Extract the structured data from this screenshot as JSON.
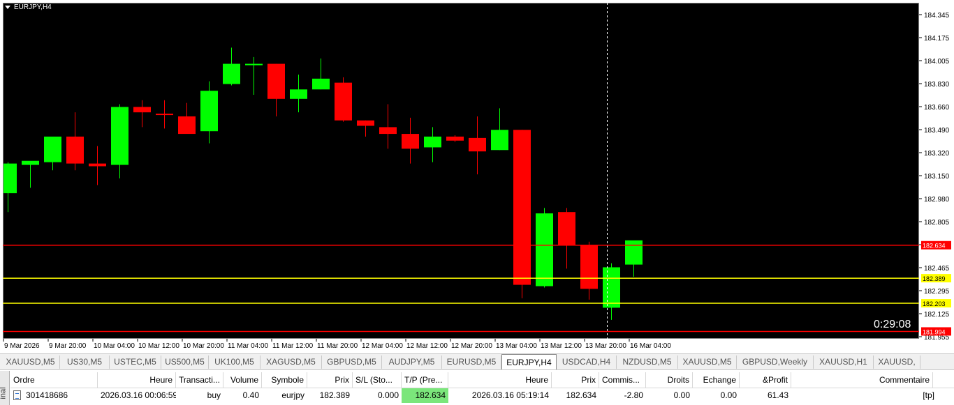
{
  "chart": {
    "symbol": "EURJPY,H4",
    "countdown": "0:29:08",
    "price_axis": [
      "184.345",
      "184.175",
      "184.005",
      "183.830",
      "183.660",
      "183.490",
      "183.320",
      "183.150",
      "182.980",
      "182.805",
      "182.635",
      "182.465",
      "182.295",
      "182.125",
      "181.955"
    ],
    "time_axis": [
      "9 Mar 2026",
      "9 Mar 20:00",
      "10 Mar 04:00",
      "10 Mar 12:00",
      "10 Mar 20:00",
      "11 Mar 04:00",
      "11 Mar 12:00",
      "11 Mar 20:00",
      "12 Mar 04:00",
      "12 Mar 12:00",
      "12 Mar 20:00",
      "13 Mar 04:00",
      "13 Mar 12:00",
      "13 Mar 20:00",
      "16 Mar 04:00"
    ],
    "levels": [
      {
        "price": 182.634,
        "label": "182.634",
        "color": "#ff0000"
      },
      {
        "price": 182.389,
        "label": "182.389",
        "color": "#ffff00"
      },
      {
        "price": 182.203,
        "label": "182.203",
        "color": "#ffff00"
      },
      {
        "price": 181.994,
        "label": "181.994",
        "color": "#ff0000"
      }
    ],
    "colors": {
      "background": "#000000",
      "bull": "#00ff00",
      "bear": "#ff0000",
      "axis_text": "#000000"
    }
  },
  "chart_data": {
    "type": "candlestick",
    "title": "EURJPY,H4",
    "ylim": [
      181.955,
      184.345
    ],
    "candles": [
      {
        "o": 183.02,
        "h": 183.25,
        "l": 182.88,
        "c": 183.24
      },
      {
        "o": 183.23,
        "h": 183.25,
        "l": 183.06,
        "c": 183.26
      },
      {
        "o": 183.25,
        "h": 183.44,
        "l": 183.19,
        "c": 183.44
      },
      {
        "o": 183.44,
        "h": 183.62,
        "l": 183.19,
        "c": 183.24
      },
      {
        "o": 183.24,
        "h": 183.37,
        "l": 183.08,
        "c": 183.22
      },
      {
        "o": 183.23,
        "h": 183.68,
        "l": 183.13,
        "c": 183.66
      },
      {
        "o": 183.66,
        "h": 183.71,
        "l": 183.51,
        "c": 183.62
      },
      {
        "o": 183.61,
        "h": 183.71,
        "l": 183.5,
        "c": 183.6
      },
      {
        "o": 183.59,
        "h": 183.69,
        "l": 183.48,
        "c": 183.46
      },
      {
        "o": 183.48,
        "h": 183.85,
        "l": 183.39,
        "c": 183.78
      },
      {
        "o": 183.83,
        "h": 184.1,
        "l": 183.82,
        "c": 183.98
      },
      {
        "o": 183.97,
        "h": 184.03,
        "l": 183.75,
        "c": 183.98
      },
      {
        "o": 183.98,
        "h": 183.98,
        "l": 183.59,
        "c": 183.72
      },
      {
        "o": 183.72,
        "h": 183.9,
        "l": 183.62,
        "c": 183.79
      },
      {
        "o": 183.79,
        "h": 184.02,
        "l": 183.79,
        "c": 183.87
      },
      {
        "o": 183.84,
        "h": 183.88,
        "l": 183.55,
        "c": 183.56
      },
      {
        "o": 183.56,
        "h": 183.56,
        "l": 183.44,
        "c": 183.52
      },
      {
        "o": 183.51,
        "h": 183.68,
        "l": 183.35,
        "c": 183.46
      },
      {
        "o": 183.46,
        "h": 183.58,
        "l": 183.24,
        "c": 183.35
      },
      {
        "o": 183.36,
        "h": 183.51,
        "l": 183.25,
        "c": 183.44
      },
      {
        "o": 183.44,
        "h": 183.45,
        "l": 183.4,
        "c": 183.41
      },
      {
        "o": 183.43,
        "h": 183.59,
        "l": 183.16,
        "c": 183.33
      },
      {
        "o": 183.34,
        "h": 183.65,
        "l": 183.34,
        "c": 183.49
      },
      {
        "o": 183.49,
        "h": 183.49,
        "l": 182.24,
        "c": 182.34
      },
      {
        "o": 182.33,
        "h": 182.91,
        "l": 182.32,
        "c": 182.87
      },
      {
        "o": 182.88,
        "h": 182.91,
        "l": 182.46,
        "c": 182.63
      },
      {
        "o": 182.63,
        "h": 182.66,
        "l": 182.23,
        "c": 182.31
      },
      {
        "o": 182.17,
        "h": 182.5,
        "l": 182.08,
        "c": 182.47
      },
      {
        "o": 182.49,
        "h": 182.66,
        "l": 182.4,
        "c": 182.67
      }
    ]
  },
  "tabs": [
    {
      "label": "XAUUSD,M5",
      "active": false
    },
    {
      "label": "US30,M5",
      "active": false
    },
    {
      "label": "USTEC,M5",
      "active": false
    },
    {
      "label": "US500,M5",
      "active": false
    },
    {
      "label": "UK100,M5",
      "active": false
    },
    {
      "label": "XAGUSD,M5",
      "active": false
    },
    {
      "label": "GBPUSD,M5",
      "active": false
    },
    {
      "label": "AUDJPY,M5",
      "active": false
    },
    {
      "label": "EURUSD,M5",
      "active": false
    },
    {
      "label": "EURJPY,H4",
      "active": true
    },
    {
      "label": "USDCAD,H4",
      "active": false
    },
    {
      "label": "NZDUSD,M5",
      "active": false
    },
    {
      "label": "XAUUSD,M5",
      "active": false
    },
    {
      "label": "GBPUSD,Weekly",
      "active": false
    },
    {
      "label": "XAUUSD,H1",
      "active": false
    },
    {
      "label": "XAUUSD,",
      "active": false
    }
  ],
  "terminal": {
    "side_label": "inal",
    "headers": [
      "Ordre",
      "Heure",
      "Transacti...",
      "Volume",
      "Symbole",
      "Prix",
      "S/L (Sto...",
      "T/P (Pre...",
      "Heure",
      "Prix",
      "Commis...",
      "Droits",
      "Echange",
      "&Profit",
      "Commentaire"
    ],
    "row": [
      "301418686",
      "2026.03.16 00:06:59",
      "buy",
      "0.40",
      "eurjpy",
      "182.389",
      "0.000",
      "182.634",
      "2026.03.16 05:19:14",
      "182.634",
      "-2.80",
      "0.00",
      "0.00",
      "61.43",
      "[tp]"
    ]
  }
}
